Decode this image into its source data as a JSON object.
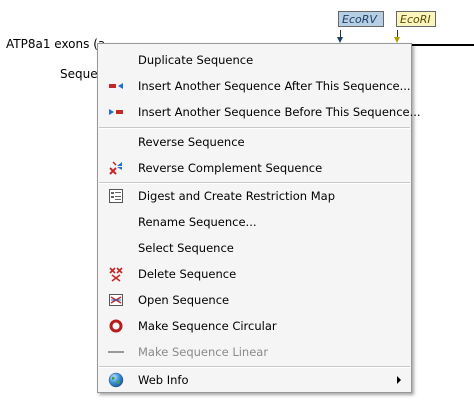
{
  "background": {
    "sequence_name": "ATP8a1 exons (a",
    "sequence_subtitle": "Sequen",
    "enzymes": [
      {
        "label": "EcoRV",
        "color": "#b7cfe2"
      },
      {
        "label": "EcoRI",
        "color": "#fbf6bd"
      }
    ]
  },
  "context_menu": {
    "items": [
      {
        "label": "Duplicate Sequence",
        "icon": "none",
        "enabled": true
      },
      {
        "label": "Insert Another Sequence After This Sequence...",
        "icon": "insert-after-icon",
        "enabled": true
      },
      {
        "label": "Insert Another Sequence Before This Sequence...",
        "icon": "insert-before-icon",
        "enabled": true
      },
      {
        "label": "Reverse Sequence",
        "icon": "none",
        "enabled": true
      },
      {
        "label": "Reverse Complement Sequence",
        "icon": "reverse-complement-icon",
        "enabled": true
      },
      {
        "label": "Digest and Create Restriction Map",
        "icon": "digest-icon",
        "enabled": true
      },
      {
        "label": "Rename Sequence...",
        "icon": "none",
        "enabled": true
      },
      {
        "label": "Select Sequence",
        "icon": "none",
        "enabled": true
      },
      {
        "label": "Delete Sequence",
        "icon": "delete-sequence-icon",
        "enabled": true
      },
      {
        "label": "Open Sequence",
        "icon": "open-sequence-icon",
        "enabled": true
      },
      {
        "label": "Make Sequence Circular",
        "icon": "circular-icon",
        "enabled": true
      },
      {
        "label": "Make Sequence Linear",
        "icon": "linear-icon",
        "enabled": false
      },
      {
        "label": "Web Info",
        "icon": "globe-icon",
        "enabled": true,
        "submenu": true
      }
    ]
  },
  "colors": {
    "menu_bg": "#f5f5f5",
    "accent_red": "#c62828",
    "accent_blue": "#1e6fd9",
    "disabled_text": "#8a8a8a"
  }
}
